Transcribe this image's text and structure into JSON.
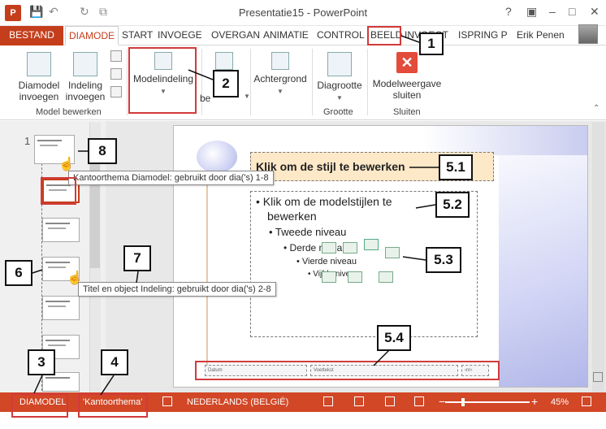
{
  "window": {
    "title": "Presentatie15 - PowerPoint",
    "app_icon": "P",
    "controls": [
      "?",
      "▣",
      "–",
      "□",
      "✕"
    ]
  },
  "qat": {
    "save_icon": "💾",
    "undo_icon": "↶",
    "redo_icon": "↻",
    "present_icon": "⧉"
  },
  "tabs": [
    {
      "label": "BESTAND"
    },
    {
      "label": "DIAMODE"
    },
    {
      "label": "START"
    },
    {
      "label": "INVOEGE"
    },
    {
      "label": "OVERGAN"
    },
    {
      "label": "ANIMATIE"
    },
    {
      "label": "CONTROL"
    },
    {
      "label": "BEELD"
    },
    {
      "label": "INVOEGT"
    },
    {
      "label": "ISPRING P"
    }
  ],
  "user": {
    "name": "Erik Penen"
  },
  "ribbon": {
    "insert_master": "Diamodel invoegen",
    "insert_layout": "Indeling invoegen",
    "group_master_edit": "Model bewerken",
    "master_layout": "Modelindeling",
    "edit_theme": "be",
    "background": "Achtergrond",
    "slide_size": "Diagrootte",
    "group_size": "Grootte",
    "close_master": "Modelweergave sluiten",
    "group_close": "Sluiten"
  },
  "slides": {
    "first_number": "1"
  },
  "tooltips": {
    "master": "Kantoorthema Diamodel: gebruikt door dia('s) 1-8",
    "layout": "Titel en object Indeling: gebruikt door dia('s) 2-8"
  },
  "slide": {
    "title": "Klik om de stijl te bewerken",
    "level1a": "• Klik om de modelstijlen te",
    "level1b": "bewerken",
    "level2": "• Tweede niveau",
    "level3": "• Derde niveau",
    "level4": "• Vierde niveau",
    "level5": "• Vijfde niveau",
    "footer_date": "Datum",
    "footer_text": "Voettekst",
    "footer_num": "‹nr›"
  },
  "status": {
    "view": "DIAMODEL",
    "theme": "'Kantoorthema'",
    "language": "NEDERLANDS (BELGIË)",
    "zoom_minus": "−",
    "zoom_plus": "+",
    "zoom": "45%"
  },
  "callouts": {
    "c1": "1",
    "c2": "2",
    "c3": "3",
    "c4": "4",
    "c6": "6",
    "c7": "7",
    "c8": "8",
    "c51": "5.1",
    "c52": "5.2",
    "c53": "5.3",
    "c54": "5.4"
  },
  "colors": {
    "accent": "#c43e1c",
    "status_bar": "#d24726",
    "annotation": "#d23a3a"
  }
}
